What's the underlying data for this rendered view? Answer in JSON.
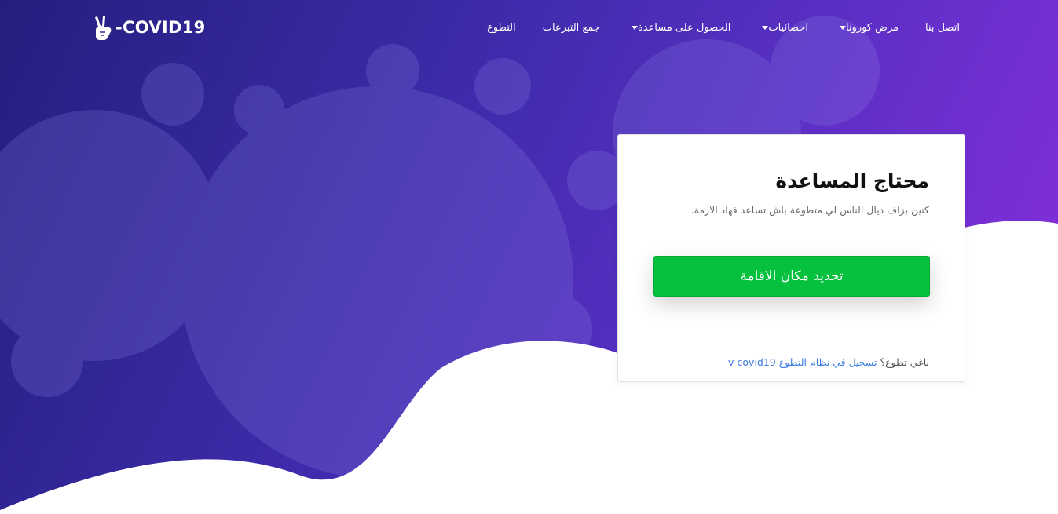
{
  "brand": {
    "name": "-COVID19",
    "icon": "victory-hand-icon"
  },
  "nav": [
    {
      "label": "اتصل بنا",
      "dropdown": false
    },
    {
      "label": "مرض كورونا",
      "dropdown": true
    },
    {
      "label": "احصائيات",
      "dropdown": true
    },
    {
      "label": "الحصول على مساعدة",
      "dropdown": true
    },
    {
      "label": "جمع التبرعات",
      "dropdown": false
    },
    {
      "label": "التطوع",
      "dropdown": false
    }
  ],
  "card": {
    "title": "محتاج المساعدة",
    "subtitle": "كنين بزاف ديال الناس لي متطوعة باش تساعد فهاد الازمة.",
    "primary_button": "تحديد مكان الاقامة",
    "footer_prefix": "باغي تطوع؟",
    "footer_link": "تسجيل في نظام التطوع v-covid19"
  },
  "colors": {
    "gradient_start": "#241f7e",
    "gradient_end": "#8e2ee0",
    "button_green": "#05c13d",
    "link_blue": "#3b7be0"
  }
}
